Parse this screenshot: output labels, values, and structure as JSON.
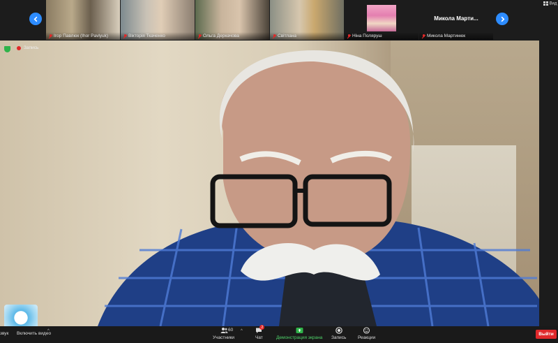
{
  "gallery": {
    "participants": [
      {
        "name": "Ігор Павлюк (Ihor Pavlyuk)",
        "muted": true
      },
      {
        "name": "Вікторія Ткаченко",
        "muted": true
      },
      {
        "name": "Ольга Деркачова",
        "muted": true
      },
      {
        "name": "Світлана",
        "muted": true
      },
      {
        "name": "Ніна Поляруш",
        "muted": true
      },
      {
        "name": "Микола Мартинюк",
        "muted": true
      }
    ],
    "text_tile_title": "Микола  Марти..."
  },
  "view_label": "Вид",
  "recording": {
    "label": "Запись"
  },
  "toolbar": {
    "left_label": "звук",
    "video_label": "Включить видео",
    "participants_label": "Участники",
    "participants_count": "60",
    "chat_label": "Чат",
    "chat_badge": "2",
    "share_label": "Демонстрация экрана",
    "record_label": "Запись",
    "reactions_label": "Реакции",
    "leave_label": "Выйти"
  },
  "colors": {
    "accent": "#2d8cff",
    "leave": "#e0282b",
    "share": "#2fb34a",
    "background": "#1a1a1a"
  }
}
